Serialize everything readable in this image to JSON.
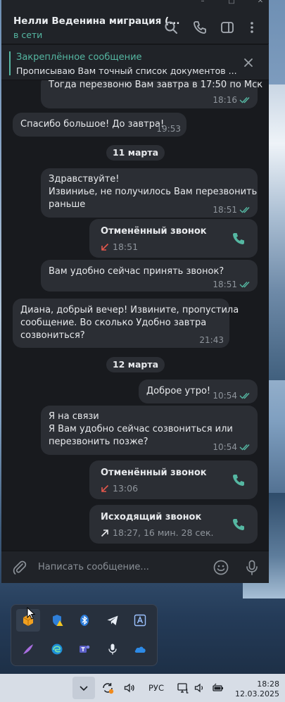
{
  "colors": {
    "accent": "#55b7a2",
    "missed": "#e2574c",
    "bubble": "#2b2e34",
    "background": "#181a1e"
  },
  "header": {
    "title": "Нелли Веденина миграция (...",
    "status": "в сети",
    "icons": [
      "search-icon",
      "phone-icon",
      "sidebar-toggle-icon",
      "more-icon"
    ]
  },
  "pinned": {
    "title": "Закреплённое сообщение",
    "text": "Прописываю Вам точный список документов ..."
  },
  "messages": {
    "m0": {
      "text": "Тогда перезвоню Вам завтра в 17:50 по Мск",
      "time": "18:16"
    },
    "m1": {
      "text": "Спасибо большое! До завтра!",
      "time": "19:53"
    },
    "d1": "11 марта",
    "m2": {
      "lines": [
        "Здравствуйте!",
        "Извиниье, не получилось Вам перезвонить",
        "раньше"
      ],
      "time": "18:51"
    },
    "c1": {
      "title": "Отменённый звонок",
      "time": "18:51"
    },
    "m3": {
      "text": "Вам удобно сейчас принять звонок?",
      "time": "18:51"
    },
    "m4": {
      "lines": [
        "Диана, добрый вечер! Извините, пропустила",
        "сообщение. Во сколько Удобно завтра",
        "созвониться?"
      ],
      "time": "21:43"
    },
    "d2": "12 марта",
    "m5": {
      "text": "Доброе утро!",
      "time": "10:54"
    },
    "m6": {
      "lines": [
        "Я на связи",
        "Я Вам удобно сейчас созвониться или",
        "перезвонить позже?"
      ],
      "time": "10:54"
    },
    "c2": {
      "title": "Отменённый звонок",
      "time": "13:06"
    },
    "c3": {
      "title": "Исходящий звонок",
      "time": "18:27, 16 мин. 28 сек."
    }
  },
  "composer": {
    "placeholder": "Написать сообщение..."
  },
  "tray": {
    "icons": [
      "package-icon",
      "shield-warning-icon",
      "bluetooth-icon",
      "telegram-icon",
      "text-app-icon",
      "feather-icon",
      "edge-icon",
      "teams-icon",
      "microphone-icon",
      "onedrive-icon"
    ]
  },
  "taskbar": {
    "language": "РУС",
    "time": "18:28",
    "date": "12.03.2025"
  }
}
